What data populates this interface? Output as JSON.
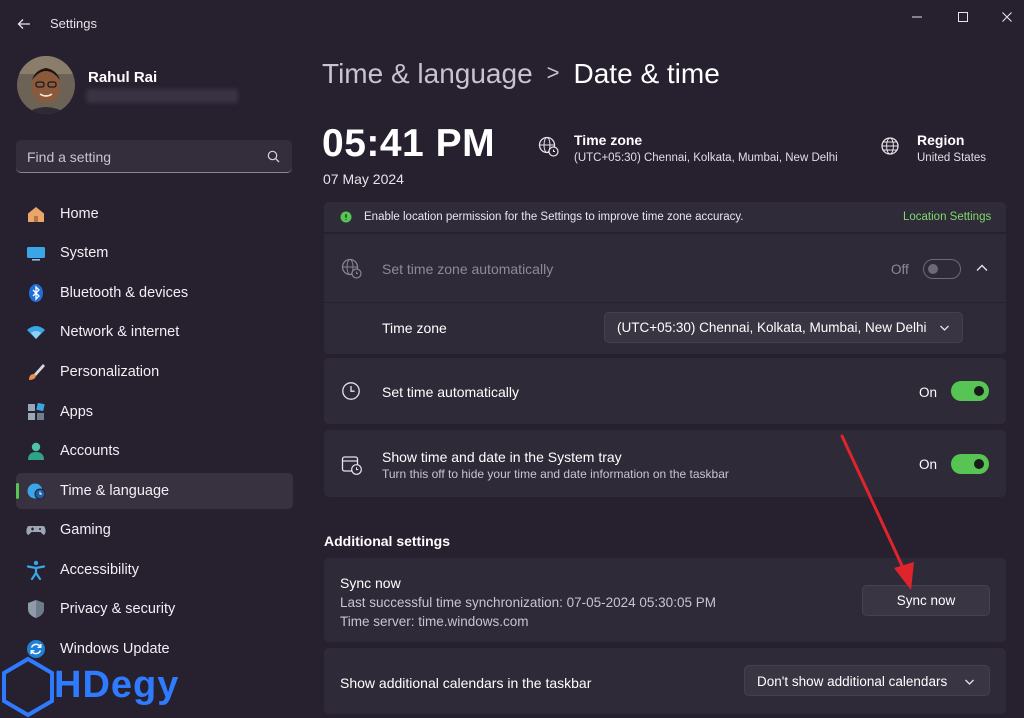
{
  "window": {
    "title": "Settings"
  },
  "profile": {
    "name": "Rahul Rai"
  },
  "search": {
    "placeholder": "Find a setting"
  },
  "sidebar": {
    "items": [
      {
        "label": "Home",
        "icon": "home-icon"
      },
      {
        "label": "System",
        "icon": "system-icon"
      },
      {
        "label": "Bluetooth & devices",
        "icon": "bluetooth-icon"
      },
      {
        "label": "Network & internet",
        "icon": "wifi-icon"
      },
      {
        "label": "Personalization",
        "icon": "brush-icon"
      },
      {
        "label": "Apps",
        "icon": "apps-icon"
      },
      {
        "label": "Accounts",
        "icon": "accounts-icon"
      },
      {
        "label": "Time & language",
        "icon": "time-language-icon",
        "active": true
      },
      {
        "label": "Gaming",
        "icon": "gamepad-icon"
      },
      {
        "label": "Accessibility",
        "icon": "accessibility-icon"
      },
      {
        "label": "Privacy & security",
        "icon": "shield-icon"
      },
      {
        "label": "Windows Update",
        "icon": "update-icon"
      }
    ]
  },
  "header": {
    "parent": "Time & language",
    "separator": ">",
    "current": "Date & time"
  },
  "clock": {
    "time": "05:41 PM",
    "date": "07 May 2024"
  },
  "timezone_info": {
    "title": "Time zone",
    "value": "(UTC+05:30) Chennai, Kolkata, Mumbai, New Delhi"
  },
  "region_info": {
    "title": "Region",
    "value": "United States"
  },
  "banner": {
    "text": "Enable location permission for the Settings to improve time zone accuracy.",
    "link": "Location Settings"
  },
  "auto_timezone": {
    "label": "Set time zone automatically",
    "state": "Off"
  },
  "timezone_row": {
    "label": "Time zone",
    "selected": "(UTC+05:30) Chennai, Kolkata, Mumbai, New Delhi"
  },
  "auto_time": {
    "label": "Set time automatically",
    "state": "On"
  },
  "tray": {
    "label": "Show time and date in the System tray",
    "description": "Turn this off to hide your time and date information on the taskbar",
    "state": "On"
  },
  "additional": {
    "heading": "Additional settings",
    "sync": {
      "title": "Sync now",
      "last_sync": "Last successful time synchronization: 07-05-2024 05:30:05 PM",
      "server": "Time server: time.windows.com",
      "button": "Sync now"
    },
    "calendars": {
      "label": "Show additional calendars in the taskbar",
      "selected": "Don't show additional calendars"
    }
  },
  "watermark": {
    "text": "HDegy"
  },
  "colors": {
    "accent_green": "#56c553",
    "link_green": "#7fd96e",
    "background": "#26202f",
    "card": "#2f2a38",
    "arrow_red": "#e0242b",
    "watermark_blue": "#2f7bff"
  }
}
